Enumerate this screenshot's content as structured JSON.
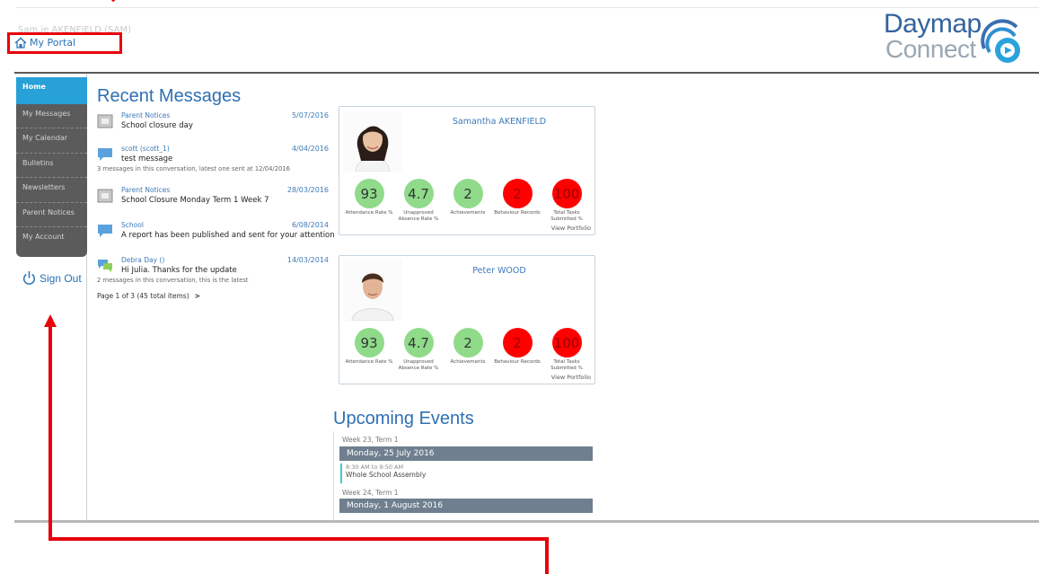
{
  "header": {
    "username": "Sam.ie AKENFIELD (SAM)",
    "portal_label": "My Portal",
    "logo_top": "Daymap",
    "logo_bottom": "Connect"
  },
  "sidebar": {
    "items": [
      {
        "label": "Home",
        "active": true
      },
      {
        "label": "My Messages"
      },
      {
        "label": "My Calendar"
      },
      {
        "label": "Bulletins"
      },
      {
        "label": "Newsletters"
      },
      {
        "label": "Parent Notices"
      },
      {
        "label": "My Account"
      }
    ],
    "sign_out": "Sign Out"
  },
  "messages": {
    "title": "Recent Messages",
    "items": [
      {
        "from": "Parent Notices",
        "date": "5/07/2016",
        "subject": "School closure day",
        "note": "",
        "icon": "notice-icon"
      },
      {
        "from": "scott (scott_1)",
        "date": "4/04/2016",
        "subject": "test message",
        "note": "3 messages in this conversation, latest one sent at 12/04/2016",
        "icon": "chat-bubble-icon"
      },
      {
        "from": "Parent Notices",
        "date": "28/03/2016",
        "subject": "School Closure Monday Term 1 Week 7",
        "note": "",
        "icon": "notice-icon"
      },
      {
        "from": "School",
        "date": "6/08/2014",
        "subject": "A report has been published and sent for your attention",
        "note": "",
        "icon": "chat-bubble-icon"
      },
      {
        "from": "Debra Day ()",
        "date": "14/03/2014",
        "subject": "Hi Julia. Thanks for the update",
        "note": "2 messages in this conversation, this is the latest",
        "icon": "chat-bubbles-icon"
      }
    ],
    "pager": "Page 1 of 3 (45 total items)",
    "pager_next": ">"
  },
  "students": [
    {
      "name": "Samantha AKENFIELD",
      "stats": [
        {
          "value": "93",
          "label": "Attendance Rate %",
          "status": "good"
        },
        {
          "value": "4.7",
          "label": "Unapproved Absence Rate %",
          "status": "good"
        },
        {
          "value": "2",
          "label": "Achievements",
          "status": "good"
        },
        {
          "value": "2",
          "label": "Behaviour Records",
          "status": "bad"
        },
        {
          "value": "100",
          "label": "Total Tasks Submitted %",
          "status": "bad"
        }
      ],
      "view_portfolio": "View Portfolio"
    },
    {
      "name": "Peter WOOD",
      "stats": [
        {
          "value": "93",
          "label": "Attendance Rate %",
          "status": "good"
        },
        {
          "value": "4.7",
          "label": "Unapproved Absence Rate %",
          "status": "good"
        },
        {
          "value": "2",
          "label": "Achievements",
          "status": "good"
        },
        {
          "value": "2",
          "label": "Behaviour Records",
          "status": "bad"
        },
        {
          "value": "100",
          "label": "Total Tasks Submitted %",
          "status": "bad"
        }
      ],
      "view_portfolio": "View Portfolio"
    }
  ],
  "events": {
    "title": "Upcoming Events",
    "weeks": [
      {
        "week": "Week 23, Term 1",
        "day": "Monday, 25 July 2016",
        "items": [
          {
            "time": "8:30 AM to 9:50 AM",
            "title": "Whole School Assembly"
          }
        ]
      },
      {
        "week": "Week 24, Term 1",
        "day": "Monday, 1 August 2016",
        "items": []
      }
    ]
  },
  "colors": {
    "accent": "#2e6fb3",
    "sidebar_bg": "#5b5b5b",
    "sidebar_active": "#27a1d8",
    "good": "#8fdb8a",
    "bad": "#ff0000",
    "annotation": "#e8000b"
  }
}
